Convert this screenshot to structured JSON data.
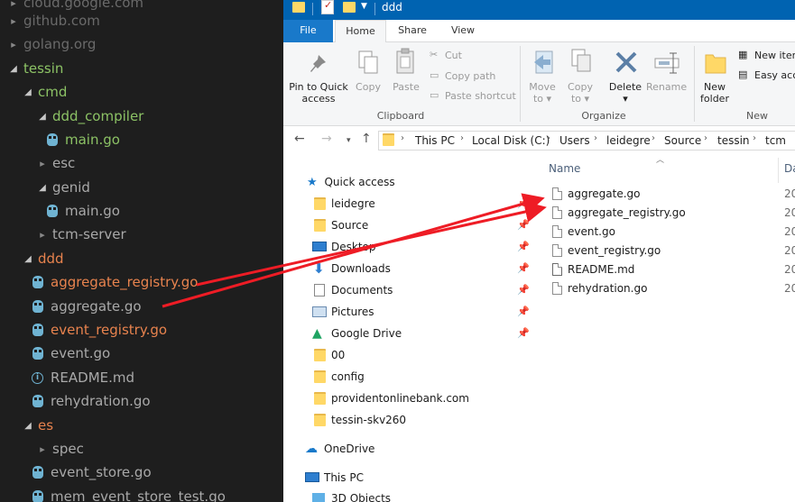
{
  "vscode_tree": {
    "items": [
      {
        "label": "cloud.google.com",
        "color": "gray",
        "kind": "folder-closed"
      },
      {
        "label": "github.com",
        "color": "gray",
        "kind": "folder-closed"
      },
      {
        "label": "golang.org",
        "color": "gray",
        "kind": "folder-closed"
      },
      {
        "label": "tessin",
        "color": "green",
        "kind": "folder-open"
      },
      {
        "label": "cmd",
        "color": "green",
        "kind": "folder-open"
      },
      {
        "label": "ddd_compiler",
        "color": "green",
        "kind": "folder-open"
      },
      {
        "label": "main.go",
        "color": "green",
        "kind": "go-file"
      },
      {
        "label": "esc",
        "color": "light",
        "kind": "folder-closed"
      },
      {
        "label": "genid",
        "color": "light",
        "kind": "folder-open"
      },
      {
        "label": "main.go",
        "color": "light",
        "kind": "go-file"
      },
      {
        "label": "tcm-server",
        "color": "light",
        "kind": "folder-closed"
      },
      {
        "label": "ddd",
        "color": "orange",
        "kind": "folder-open"
      },
      {
        "label": "aggregate_registry.go",
        "color": "orange",
        "kind": "go-file"
      },
      {
        "label": "aggregate.go",
        "color": "light",
        "kind": "go-file"
      },
      {
        "label": "event_registry.go",
        "color": "orange",
        "kind": "go-file"
      },
      {
        "label": "event.go",
        "color": "light",
        "kind": "go-file"
      },
      {
        "label": "README.md",
        "color": "light",
        "kind": "info-file"
      },
      {
        "label": "rehydration.go",
        "color": "light",
        "kind": "go-file"
      },
      {
        "label": "es",
        "color": "orange",
        "kind": "folder-open"
      },
      {
        "label": "spec",
        "color": "light",
        "kind": "folder-closed"
      },
      {
        "label": "event_store.go",
        "color": "light",
        "kind": "go-file"
      },
      {
        "label": "mem_event_store_test.go",
        "color": "light",
        "kind": "go-file"
      }
    ]
  },
  "explorer": {
    "window_title": "ddd",
    "tabs": {
      "file": "File",
      "home": "Home",
      "share": "Share",
      "view": "View"
    },
    "ribbon": {
      "pin": "Pin to Quick",
      "pin2": "access",
      "copy": "Copy",
      "paste": "Paste",
      "cut": "Cut",
      "copy_path": "Copy path",
      "paste_shortcut": "Paste shortcut",
      "move_to": "Move",
      "move_to2": "to",
      "copy_to": "Copy",
      "copy_to2": "to",
      "delete": "Delete",
      "rename": "Rename",
      "new_folder": "New",
      "new_folder2": "folder",
      "new_item": "New item",
      "easy_access": "Easy acce",
      "group_clipboard": "Clipboard",
      "group_organize": "Organize",
      "group_new": "New"
    },
    "breadcrumb": [
      "This PC",
      "Local Disk (C:)",
      "Users",
      "leidegre",
      "Source",
      "tessin",
      "tcm"
    ],
    "nav": {
      "quick_access": "Quick access",
      "items": [
        "leidegre",
        "Source",
        "Desktop",
        "Downloads",
        "Documents",
        "Pictures",
        "Google Drive",
        "00",
        "config",
        "providentonlinebank.com",
        "tessin-skv260"
      ],
      "onedrive": "OneDrive",
      "this_pc": "This PC",
      "objects_3d": "3D Objects"
    },
    "columns": {
      "name": "Name",
      "date": "Da"
    },
    "files": [
      "aggregate.go",
      "aggregate_registry.go",
      "event.go",
      "event_registry.go",
      "README.md",
      "rehydration.go"
    ],
    "date_prefix": "20"
  },
  "colors": {
    "arrow": "#ee1c25",
    "titlebar": "#0063b1",
    "file_tab": "#1979ca",
    "folder": "#ffd867"
  }
}
